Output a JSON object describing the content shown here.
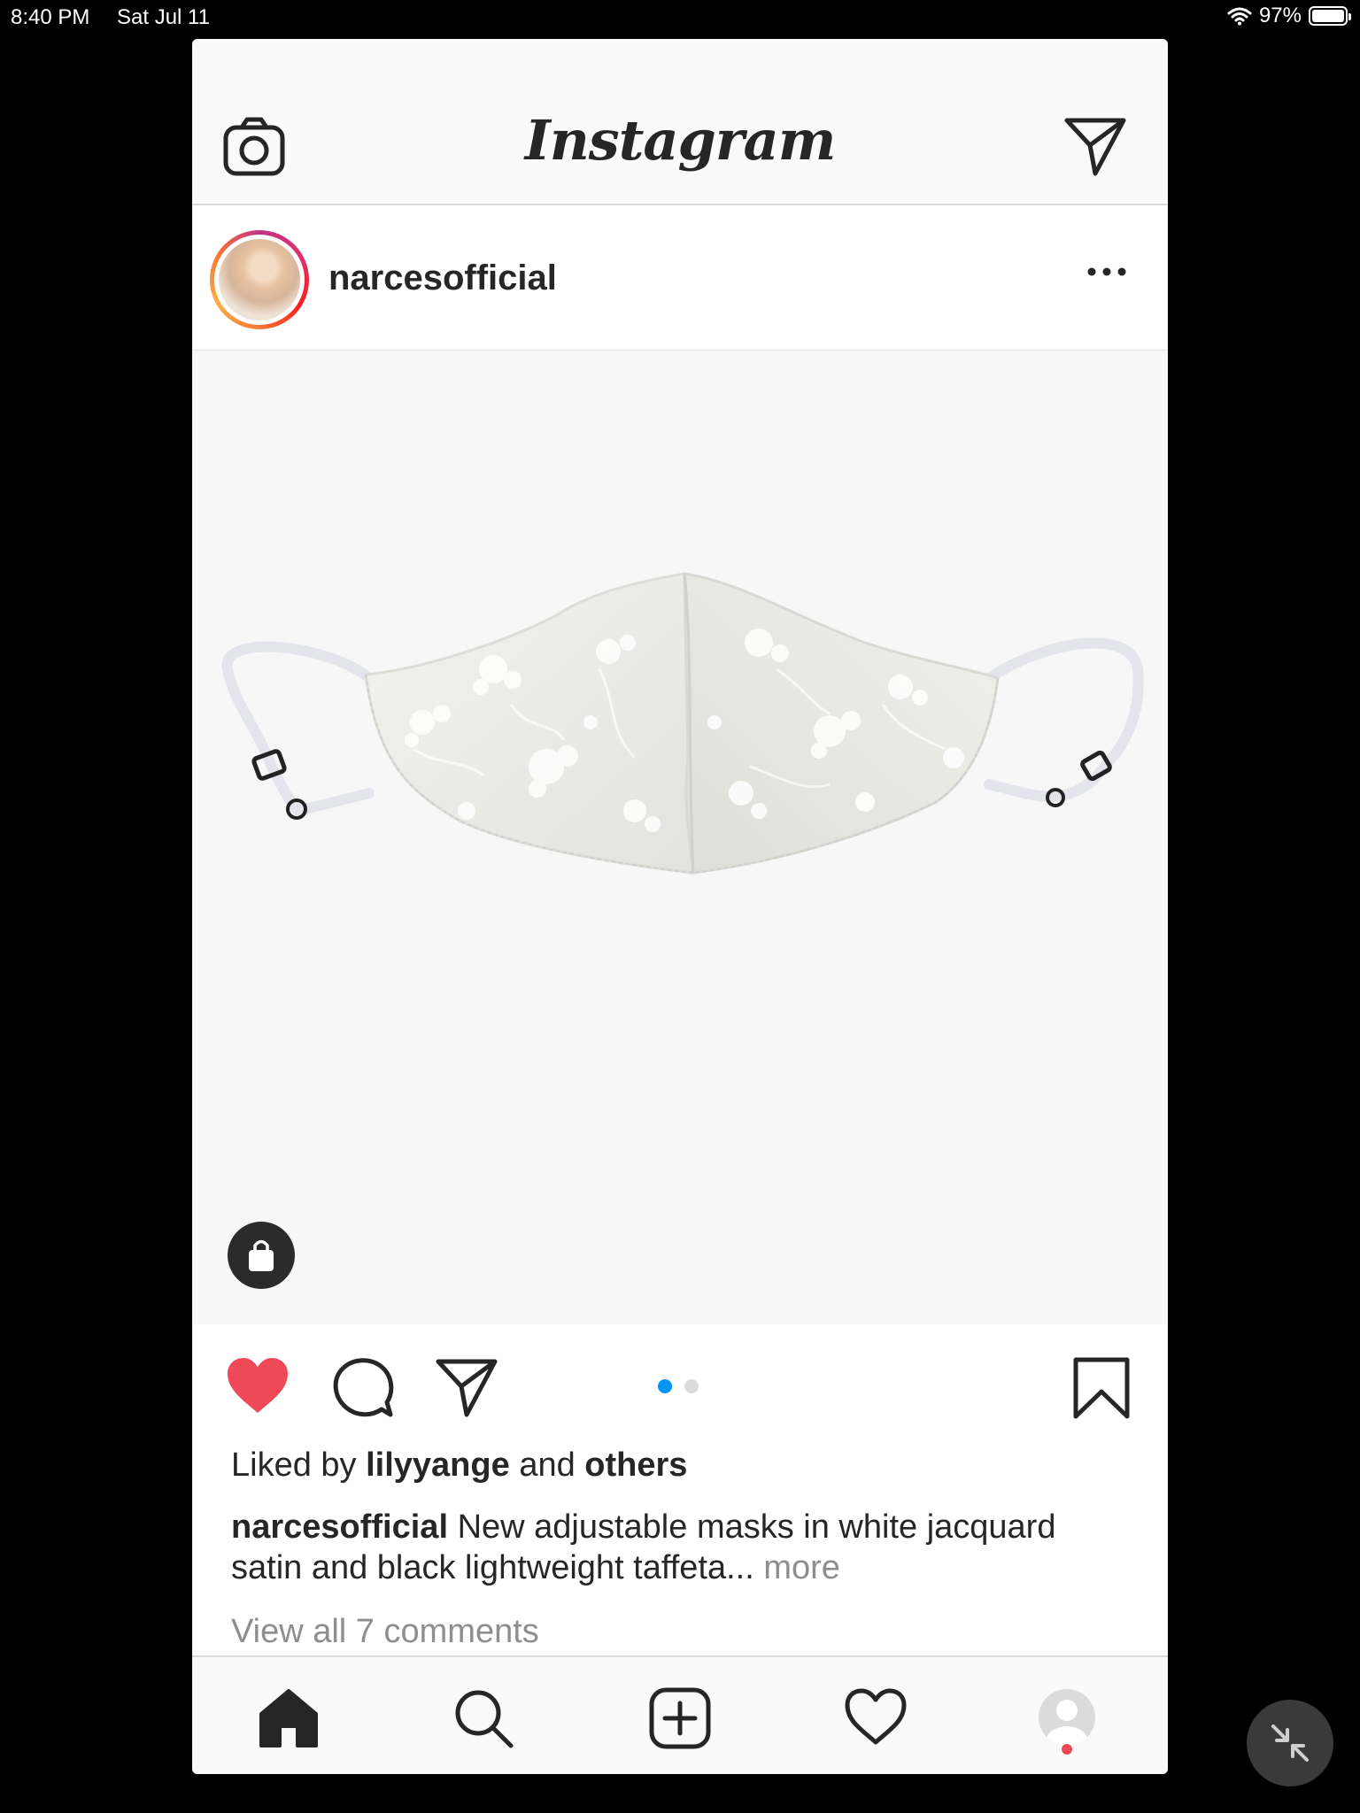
{
  "status_bar": {
    "time": "8:40 PM",
    "date": "Sat Jul 11",
    "battery_percent": "97%"
  },
  "header": {
    "title": "Instagram",
    "camera_icon": "camera-icon",
    "direct_icon": "paper-plane-icon"
  },
  "post": {
    "username": "narcesofficial",
    "avatar_icon": "profile-picture",
    "options_icon": "ellipsis-icon",
    "image": {
      "subject": "white jacquard satin face mask",
      "shopping_icon": "shopping-bag-icon"
    },
    "carousel": {
      "count": 2,
      "active_index": 0,
      "active_color": "#0095f6",
      "inactive_color": "#dbdbdb"
    },
    "actions": {
      "liked": true,
      "like_color": "#ed4956"
    },
    "likes": {
      "prefix": "Liked by",
      "user": "lilyyange",
      "middle": "and",
      "others": "others"
    },
    "caption": {
      "username": "narcesofficial",
      "text": "New adjustable masks in white jacquard satin and black lightweight taffeta...",
      "more": "more"
    },
    "comments_link": "View all 7 comments"
  },
  "tab_bar": {
    "items": [
      "home-icon",
      "search-icon",
      "new-post-icon",
      "activity-heart-icon",
      "profile-icon"
    ],
    "notification_color": "#ed4956"
  },
  "overlay": {
    "collapse_icon": "collapse-arrows-icon"
  }
}
